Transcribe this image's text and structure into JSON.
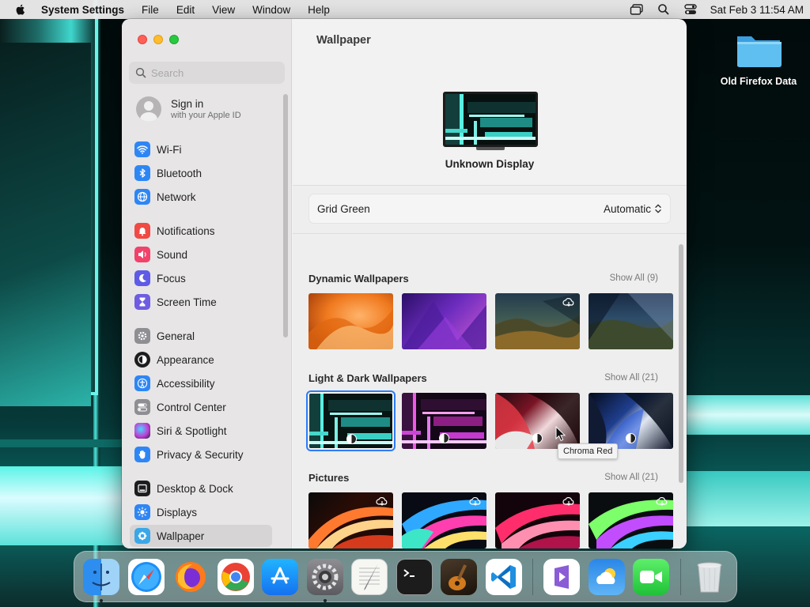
{
  "menubar": {
    "app_name": "System Settings",
    "menus": [
      "File",
      "Edit",
      "View",
      "Window",
      "Help"
    ],
    "clock": "Sat Feb 3  11:54 AM"
  },
  "desktop": {
    "folder_label": "Old Firefox Data"
  },
  "sidebar": {
    "search_placeholder": "Search",
    "signin": {
      "title": "Sign in",
      "subtitle": "with your Apple ID"
    },
    "items": [
      {
        "label": "Wi-Fi",
        "icon": "wifi-icon",
        "color": "#2e86f5"
      },
      {
        "label": "Bluetooth",
        "icon": "bluetooth-icon",
        "color": "#2e86f5"
      },
      {
        "label": "Network",
        "icon": "globe-icon",
        "color": "#2e86f5"
      },
      {
        "label": "Notifications",
        "icon": "bell-icon",
        "color": "#f04a43"
      },
      {
        "label": "Sound",
        "icon": "speaker-icon",
        "color": "#f0426a"
      },
      {
        "label": "Focus",
        "icon": "moon-icon",
        "color": "#5e5ce6"
      },
      {
        "label": "Screen Time",
        "icon": "hourglass-icon",
        "color": "#6e5de0"
      },
      {
        "label": "General",
        "icon": "gear-icon",
        "color": "#8e8e93"
      },
      {
        "label": "Appearance",
        "icon": "appearance-icon",
        "color": "#1d1d1f"
      },
      {
        "label": "Accessibility",
        "icon": "accessibility-icon",
        "color": "#2e86f5"
      },
      {
        "label": "Control Center",
        "icon": "toggles-icon",
        "color": "#8e8e93"
      },
      {
        "label": "Siri & Spotlight",
        "icon": "siri-icon",
        "color": "#c03fd6"
      },
      {
        "label": "Privacy & Security",
        "icon": "hand-icon",
        "color": "#2e86f5"
      },
      {
        "label": "Desktop & Dock",
        "icon": "dock-icon",
        "color": "#1d1d1f"
      },
      {
        "label": "Displays",
        "icon": "sun-icon",
        "color": "#2e86f5"
      },
      {
        "label": "Wallpaper",
        "icon": "wallpaper-icon",
        "color": "#3aa7e8"
      }
    ]
  },
  "content": {
    "title": "Wallpaper",
    "display_name": "Unknown Display",
    "current_wallpaper": "Grid Green",
    "mode_value": "Automatic",
    "sections": [
      {
        "title": "Dynamic Wallpapers",
        "show_all": "Show All (9)"
      },
      {
        "title": "Light & Dark Wallpapers",
        "show_all": "Show All (21)"
      },
      {
        "title": "Pictures",
        "show_all": "Show All (21)"
      }
    ],
    "tooltip": "Chroma Red"
  },
  "dock": {
    "apps": [
      "finder-icon",
      "safari-icon",
      "firefox-icon",
      "chrome-icon",
      "app-store-icon",
      "system-settings-icon",
      "textedit-icon",
      "terminal-icon",
      "instruments-icon",
      "vscode-icon",
      "visual-studio-icon",
      "weather-icon",
      "facetime-icon",
      "trash-icon"
    ]
  }
}
